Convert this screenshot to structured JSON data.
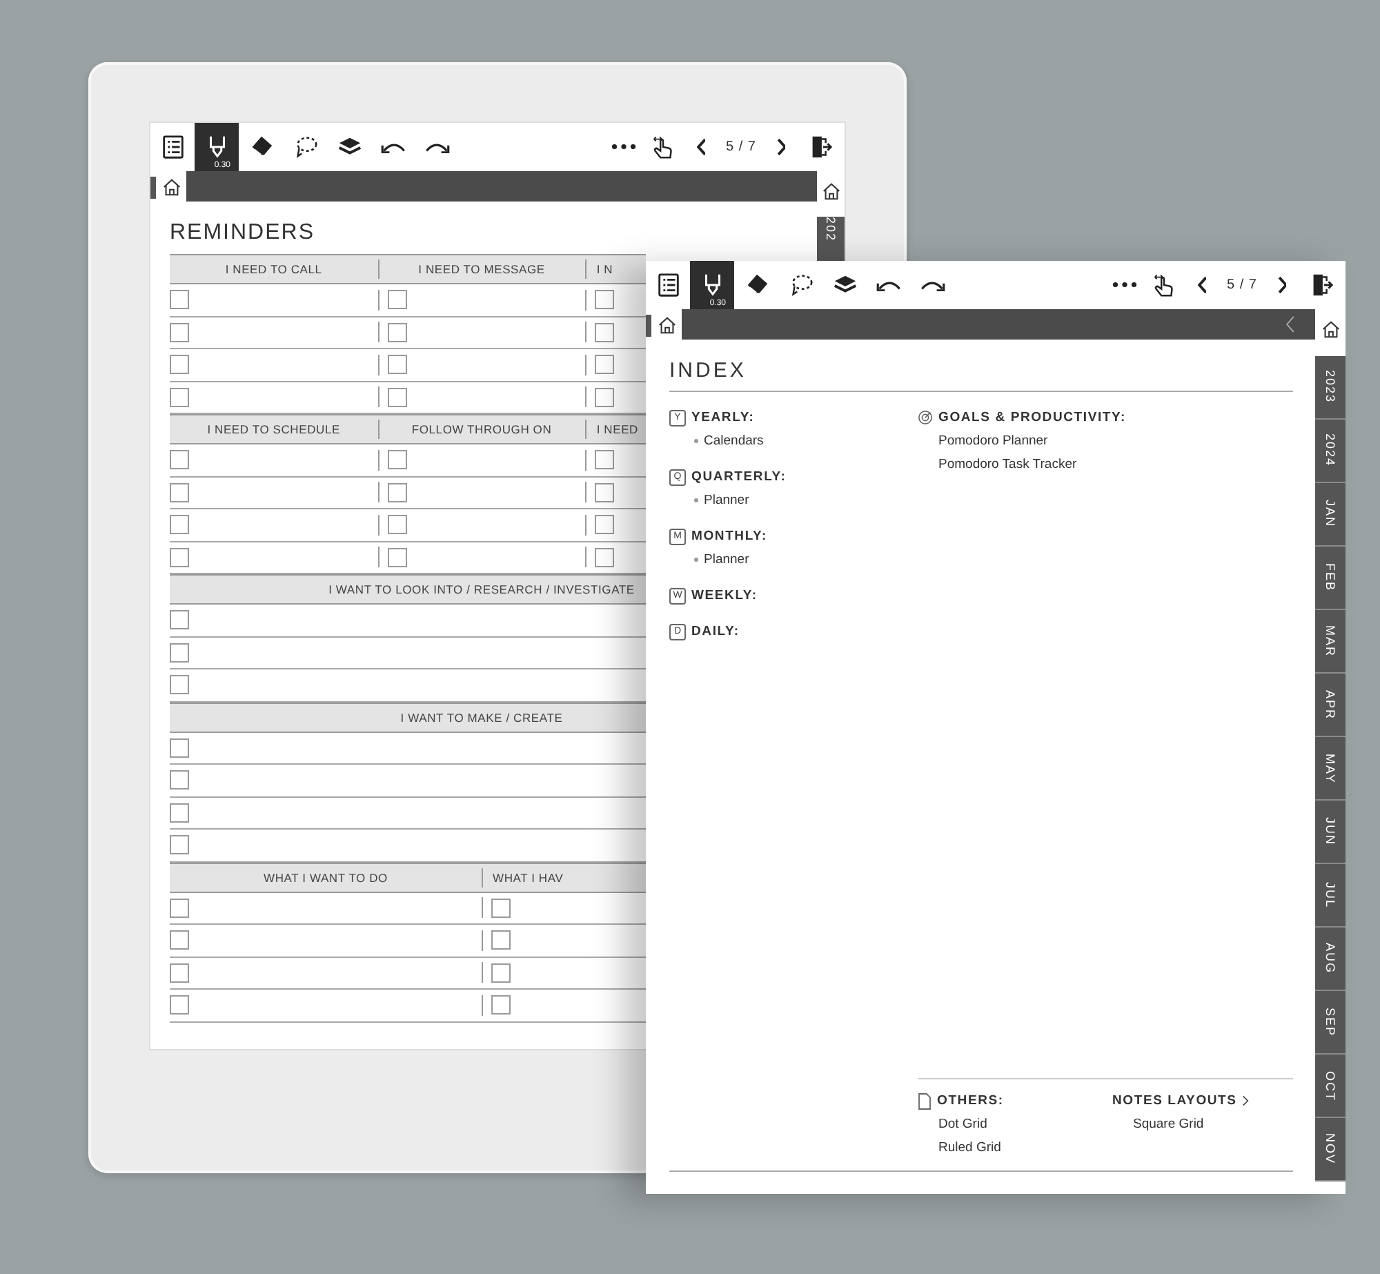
{
  "reminders_screen": {
    "toolbar": {
      "tools": [
        {
          "kind": "list",
          "selected": false
        },
        {
          "kind": "pen",
          "selected": true,
          "size": "0.30"
        },
        {
          "kind": "eraser",
          "selected": false
        },
        {
          "kind": "lasso",
          "selected": false
        },
        {
          "kind": "layers",
          "selected": false
        },
        {
          "kind": "undo",
          "selected": false
        },
        {
          "kind": "redo",
          "selected": false
        }
      ],
      "actions": [
        {
          "kind": "more"
        },
        {
          "kind": "touch"
        },
        {
          "kind": "prev"
        },
        {
          "kind": "page",
          "label": "5 / 7"
        },
        {
          "kind": "next"
        },
        {
          "kind": "exit"
        }
      ]
    },
    "title": "REMINDERS",
    "sections": [
      {
        "headers": [
          "I NEED TO CALL",
          "I NEED TO MESSAGE",
          "I N"
        ],
        "rows": [
          {
            "checked": [
              false,
              false,
              false
            ]
          },
          {
            "checked": [
              false,
              false,
              false
            ]
          },
          {
            "checked": [
              false,
              false,
              false
            ]
          },
          {
            "checked": [
              false,
              false,
              false
            ]
          }
        ]
      },
      {
        "headers": [
          "I NEED TO SCHEDULE",
          "FOLLOW THROUGH ON",
          "I NEED"
        ],
        "rows": [
          {
            "checked": [
              false,
              false,
              false
            ]
          },
          {
            "checked": [
              false,
              false,
              false
            ]
          },
          {
            "checked": [
              false,
              false,
              false
            ]
          },
          {
            "checked": [
              false,
              false,
              false
            ]
          }
        ]
      },
      {
        "headers": [
          "I WANT TO LOOK INTO / RESEARCH / INVESTIGATE"
        ],
        "rows": [
          {
            "checked": [
              false
            ]
          },
          {
            "checked": [
              false
            ]
          },
          {
            "checked": [
              false
            ]
          }
        ]
      },
      {
        "headers": [
          "I WANT TO MAKE / CREATE"
        ],
        "rows": [
          {
            "checked": [
              false
            ]
          },
          {
            "checked": [
              false
            ]
          },
          {
            "checked": [
              false
            ]
          },
          {
            "checked": [
              false
            ]
          }
        ]
      },
      {
        "headers": [
          "WHAT I WANT TO DO",
          "WHAT I HAV"
        ],
        "rows": [
          {
            "checked": [
              false,
              false
            ]
          },
          {
            "checked": [
              false,
              false
            ]
          },
          {
            "checked": [
              false,
              false
            ]
          },
          {
            "checked": [
              false,
              false
            ]
          }
        ]
      }
    ],
    "side_tabs": [
      {
        "label": "202"
      }
    ]
  },
  "index_screen": {
    "toolbar": {
      "tools": [
        {
          "kind": "list",
          "selected": false
        },
        {
          "kind": "pen",
          "selected": true,
          "size": "0.30"
        },
        {
          "kind": "eraser",
          "selected": false
        },
        {
          "kind": "lasso",
          "selected": false
        },
        {
          "kind": "layers",
          "selected": false
        },
        {
          "kind": "undo",
          "selected": false
        },
        {
          "kind": "redo",
          "selected": false
        }
      ],
      "actions": [
        {
          "kind": "more"
        },
        {
          "kind": "touch"
        },
        {
          "kind": "prev"
        },
        {
          "kind": "page",
          "label": "5 / 7"
        },
        {
          "kind": "next"
        },
        {
          "kind": "exit"
        }
      ]
    },
    "title": "INDEX",
    "left_sections": [
      {
        "badge": "Y",
        "title": "YEARLY:",
        "items": [
          "Calendars"
        ]
      },
      {
        "badge": "Q",
        "title": "QUARTERLY:",
        "items": [
          "Planner"
        ]
      },
      {
        "badge": "M",
        "title": "MONTHLY:",
        "items": [
          "Planner"
        ]
      },
      {
        "badge": "W",
        "title": "WEEKLY:"
      },
      {
        "badge": "D",
        "title": "DAILY:"
      }
    ],
    "right_sections": [
      {
        "title": "GOALS & PRODUCTIVITY:",
        "items": [
          "Pomodoro Planner",
          "Pomodoro Task Tracker"
        ]
      }
    ],
    "others": {
      "title": "OTHERS:",
      "items": [
        "Dot Grid",
        "Ruled Grid"
      ]
    },
    "notes_layouts": {
      "title": "NOTES LAYOUTS",
      "items": [
        "Square Grid"
      ]
    },
    "side_tabs": [
      {
        "label": "2023"
      },
      {
        "label": "2024"
      },
      {
        "label": "JAN"
      },
      {
        "label": "FEB"
      },
      {
        "label": "MAR"
      },
      {
        "label": "APR"
      },
      {
        "label": "MAY"
      },
      {
        "label": "JUN"
      },
      {
        "label": "JUL"
      },
      {
        "label": "AUG"
      },
      {
        "label": "SEP"
      },
      {
        "label": "OCT"
      },
      {
        "label": "NOV"
      }
    ]
  }
}
